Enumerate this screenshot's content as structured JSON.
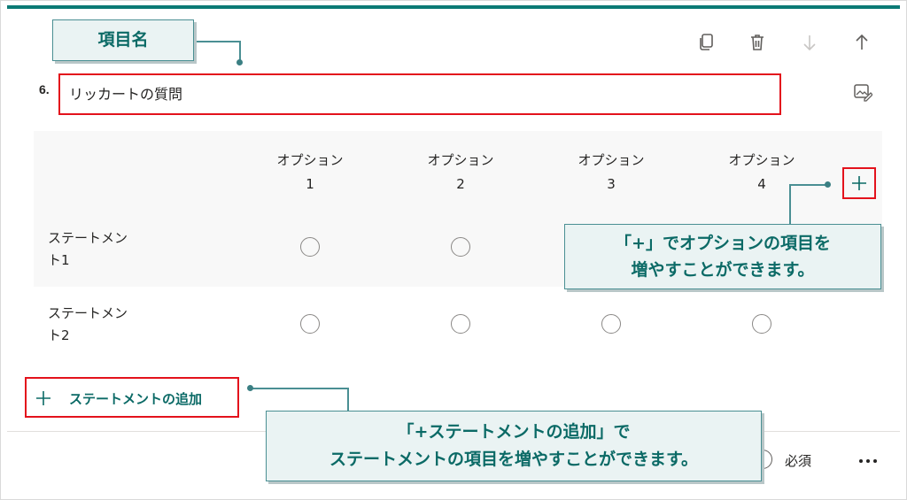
{
  "question": {
    "number": "6.",
    "title": "リッカートの質問"
  },
  "toolbar": {
    "copy_icon": "copy-icon",
    "delete_icon": "trash-icon",
    "move_down_icon": "arrow-down-icon",
    "move_up_icon": "arrow-up-icon",
    "title_edit_icon": "image-edit-icon"
  },
  "options": [
    {
      "line1": "オプション",
      "line2": "1"
    },
    {
      "line1": "オプション",
      "line2": "2"
    },
    {
      "line1": "オプション",
      "line2": "3"
    },
    {
      "line1": "オプション",
      "line2": "4"
    }
  ],
  "statements": [
    {
      "line1": "ステートメン",
      "line2": "ト1"
    },
    {
      "line1": "ステートメン",
      "line2": "ト2"
    }
  ],
  "add_statement": {
    "icon": "plus-icon",
    "label": "ステートメントの追加"
  },
  "add_option_icon": "plus-icon",
  "footer": {
    "required_label": "必須",
    "more_icon": "ellipsis-icon"
  },
  "callouts": {
    "item_name": "項目名",
    "add_option_line1": "「+」でオプションの項目を",
    "add_option_line2": "増やすことができます。",
    "add_statement_line1": "「+ステートメントの追加」で",
    "add_statement_line2": "ステートメントの項目を増やすことができます。"
  },
  "colors": {
    "accent": "#0b7a75",
    "highlight": "#e3121c",
    "callout_bg": "#eaf3f3",
    "callout_border": "#4a8f93"
  }
}
